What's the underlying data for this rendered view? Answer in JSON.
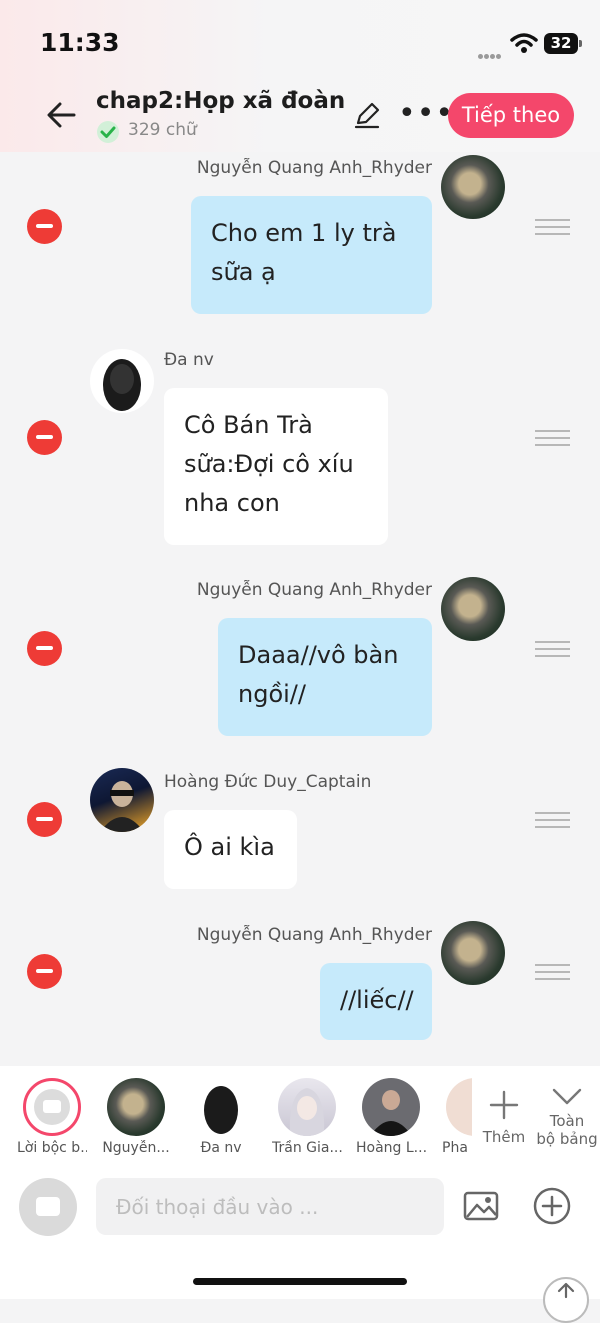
{
  "status_bar": {
    "time": "11:33",
    "battery": "32"
  },
  "header": {
    "title": "chap2:Họp xã đoàn",
    "word_count": "329 chữ",
    "next_label": "Tiếp theo"
  },
  "messages": [
    {
      "speaker": "Nguyễn Quang Anh_Rhyder",
      "text": "Cho em 1 ly trà sữa ạ",
      "side": "right"
    },
    {
      "speaker": "Đa nv",
      "text": "Cô Bán Trà sữa:Đợi cô xíu nha con",
      "side": "left"
    },
    {
      "speaker": "Nguyễn Quang Anh_Rhyder",
      "text": "Daaa//vô bàn ngồi//",
      "side": "right"
    },
    {
      "speaker": "Hoàng Đức Duy_Captain",
      "text": "Ô ai kìa",
      "side": "left"
    },
    {
      "speaker": "Nguyễn Quang Anh_Rhyder",
      "text": "//liếc//",
      "side": "right"
    }
  ],
  "characters": [
    {
      "label": "Lời bộc b..."
    },
    {
      "label": "Nguyễn..."
    },
    {
      "label": "Đa nv"
    },
    {
      "label": "Trần Gia..."
    },
    {
      "label": "Hoàng L..."
    },
    {
      "label": "Pha"
    }
  ],
  "tray_actions": {
    "add_label": "Thêm",
    "all_label_1": "Toàn",
    "all_label_2": "bộ bảng"
  },
  "composer": {
    "placeholder": "Đối thoại đầu vào ..."
  }
}
